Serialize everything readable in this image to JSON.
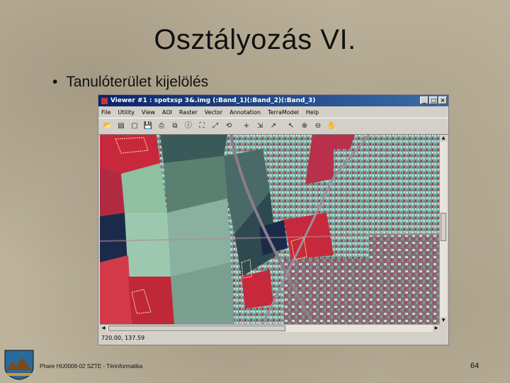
{
  "slide": {
    "title": "Osztályozás VI.",
    "bullet": "Tanulóterület kijelölés",
    "bullet_glyph": "•",
    "footer_credit": "Phare HU0008-02 SZTE - Térinformatika",
    "page_number": "64"
  },
  "window": {
    "title": "Viewer #1 : spotxsp 3&.img (:Band_1)(:Band_2)(:Band_3)",
    "controls": [
      "_",
      "□",
      "×"
    ],
    "menu": [
      "File",
      "Utility",
      "View",
      "AOI",
      "Raster",
      "Vector",
      "Annotation",
      "TerraModel",
      "Help"
    ],
    "tools": [
      {
        "name": "open-icon",
        "glyph": "📂"
      },
      {
        "name": "layer-open-icon",
        "glyph": "▤"
      },
      {
        "name": "new-icon",
        "glyph": "▢"
      },
      {
        "name": "save-icon",
        "glyph": "💾"
      },
      {
        "name": "print-icon",
        "glyph": "⎙"
      },
      {
        "name": "layers-icon",
        "glyph": "⧉"
      },
      {
        "name": "info-icon",
        "glyph": "ⓘ"
      },
      {
        "name": "fit-icon",
        "glyph": "⛶"
      },
      {
        "name": "resize-icon",
        "glyph": "⤢"
      },
      {
        "name": "pan-all-icon",
        "glyph": "⟲"
      },
      {
        "name": "crosshair-icon",
        "glyph": "+"
      },
      {
        "name": "roam-icon",
        "glyph": "⇲"
      },
      {
        "name": "profile-icon",
        "glyph": "↗"
      },
      {
        "name": "select-arrow-icon",
        "glyph": "↖"
      },
      {
        "name": "zoom-in-icon",
        "glyph": "⊕"
      },
      {
        "name": "zoom-out-icon",
        "glyph": "⊖"
      },
      {
        "name": "pan-icon",
        "glyph": "✋"
      }
    ],
    "status_text": "720.00, 137.59",
    "scroll_up": "▲",
    "scroll_down": "▼",
    "scroll_left": "◀",
    "scroll_right": "▶"
  },
  "colors": {
    "vegetation_red": "#c8283c",
    "urban_cyan": "#7ab8b0",
    "field_green": "#8fc0a0",
    "water_dark": "#1c2a4a",
    "aoi_outline": "#ffe0a0"
  }
}
